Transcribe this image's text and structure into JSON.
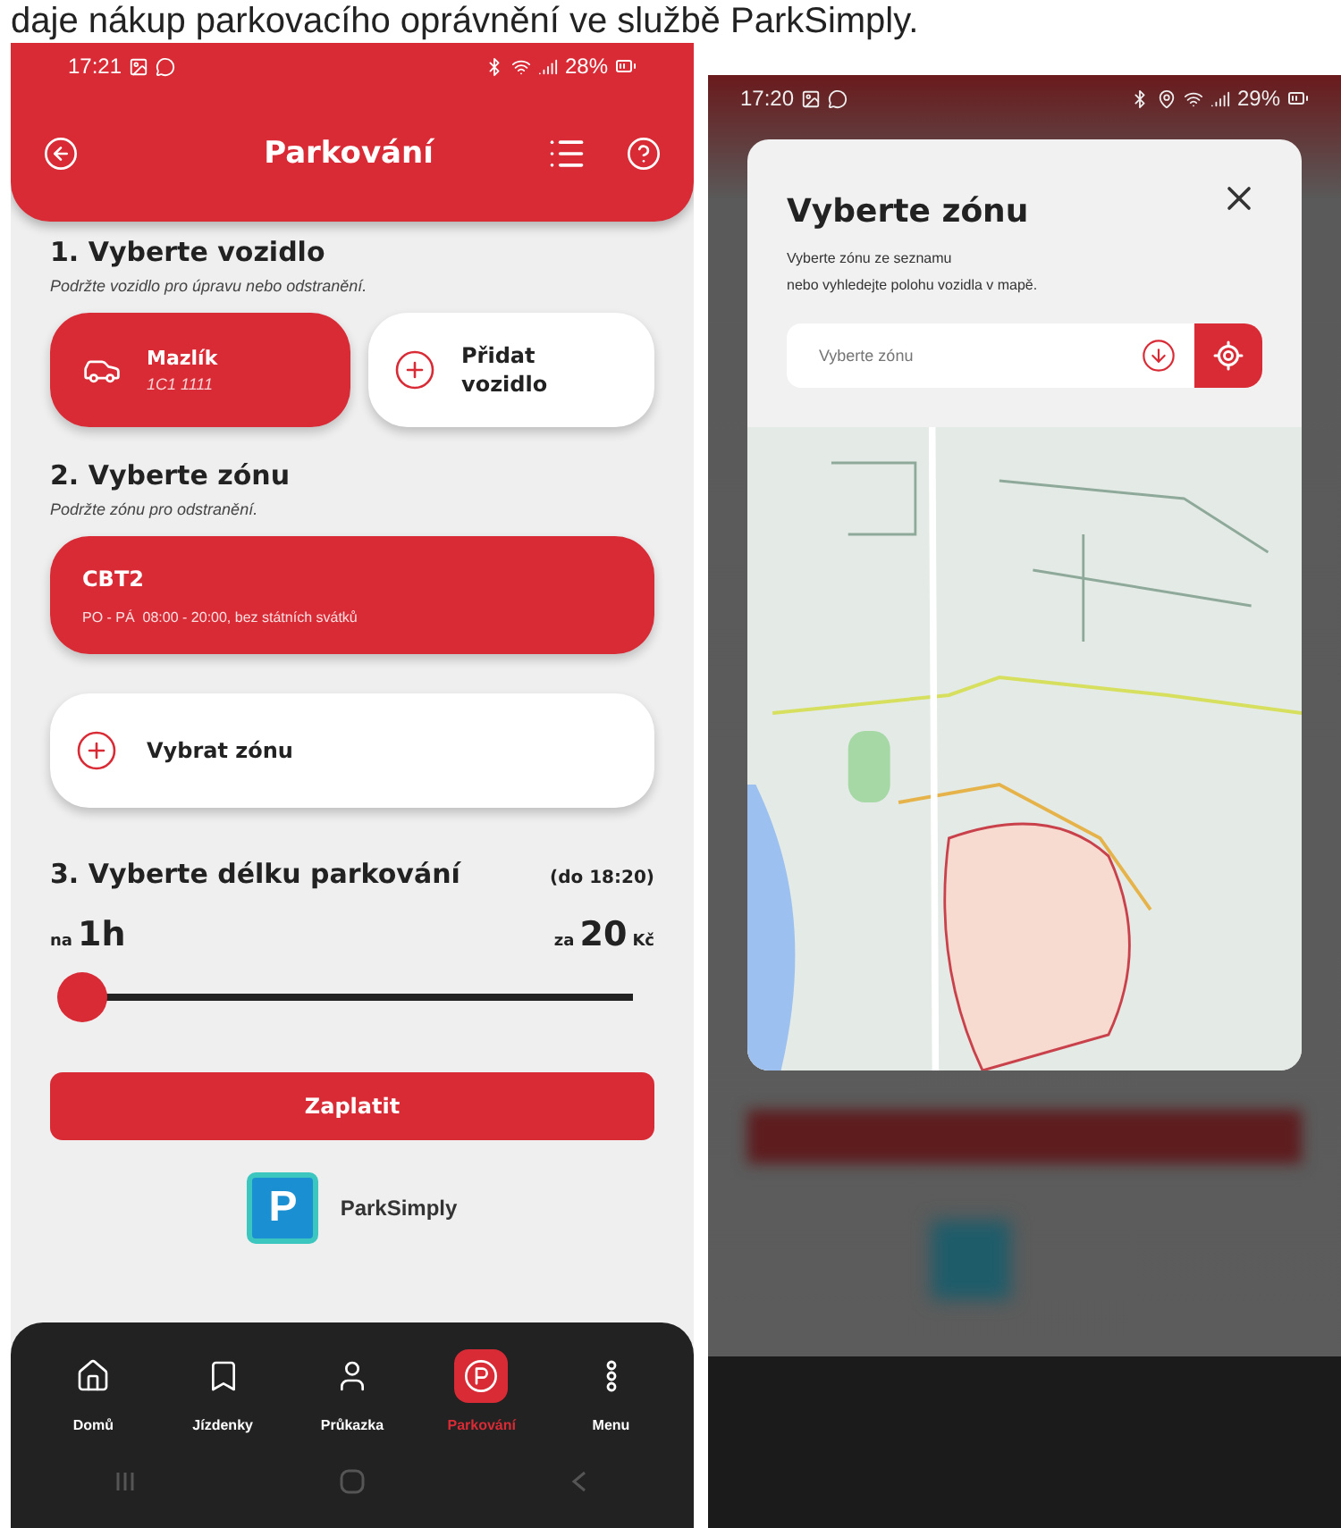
{
  "caption": "daje nákup parkovacího oprávnění ve službě ParkSimply.",
  "parking_screen": {
    "status_bar": {
      "time": "17:21",
      "battery": "28%"
    },
    "header": {
      "title": "Parkování"
    },
    "vehicle_section": {
      "title": "1. Vyberte vozidlo",
      "hint": "Podržte vozidlo pro úpravu nebo odstranění.",
      "vehicles": [
        {
          "name": "Mazlík",
          "plate": "1C1 1111",
          "selected": true
        }
      ],
      "add_label": "Přidat vozidlo"
    },
    "zone_section": {
      "title": "2. Vyberte zónu",
      "hint": "Podržte zónu pro odstranění.",
      "zones": [
        {
          "code": "CBT2",
          "hours": "PO - PÁ  08:00 - 20:00, bez státních svátků",
          "selected": true
        }
      ],
      "add_label": "Vybrat zónu"
    },
    "duration_section": {
      "title": "3. Vyberte délku parkování",
      "until": "(do 18:20)",
      "duration_prefix": "na",
      "duration": "1h",
      "price_prefix": "za",
      "price": "20",
      "currency": "Kč",
      "slider": {
        "level": 0
      }
    },
    "pay_button": "Zaplatit",
    "provider": {
      "logo_letter": "P",
      "name": "ParkSimply"
    },
    "nav": [
      {
        "label": "Domů",
        "selected": false
      },
      {
        "label": "Jízdenky",
        "selected": false
      },
      {
        "label": "Průkazka",
        "selected": false
      },
      {
        "label": "Parkování",
        "selected": true
      },
      {
        "label": "Menu",
        "selected": false
      }
    ]
  },
  "zone_dialog_screen": {
    "status_bar": {
      "time": "17:20",
      "battery": "29%"
    },
    "dialog": {
      "title": "Vyberte zónu",
      "description_lines": [
        "Vyberte zónu ze seznamu",
        "nebo vyhledejte polohu vozidla v mapě."
      ],
      "search": {
        "placeholder": "Vyberte zónu"
      }
    }
  }
}
